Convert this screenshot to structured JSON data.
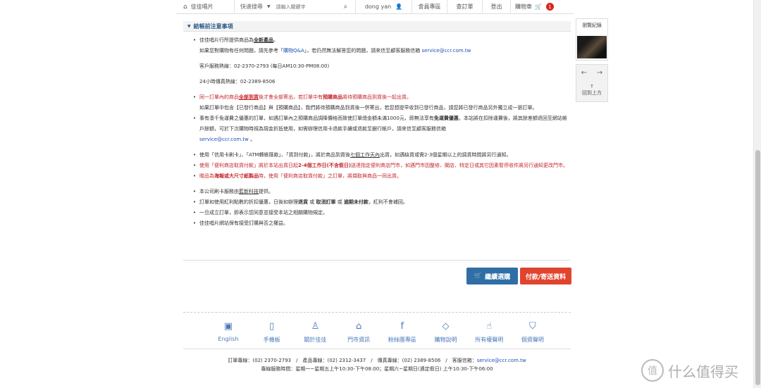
{
  "topbar": {
    "site_name": "佳佳唱片",
    "search_label": "快速搜尋",
    "search_placeholder": "請輸入關鍵字",
    "user": "dong yan",
    "member_zone": "會員專區",
    "check_order": "查訂單",
    "logout": "登出",
    "cart": "購物車",
    "cart_count": "1"
  },
  "sidebar": {
    "browse_history": "瀏覽紀錄",
    "back_to_top": "回到上方"
  },
  "notice": {
    "title": "結帳前注意事項",
    "l1": "佳佳唱片行所提供商品為",
    "l1_u": "全新產品",
    "l1_end": "。",
    "l2_pre": "如果您對購物有任何問題，請先參考「",
    "l2_link": "購物Q&A",
    "l2_mid": "」，若仍然無法解答您的問題，請來信至顧客服務信箱 ",
    "email": "service@ccr.com.tw",
    "l3": "客戶服務熱線：02-2370-2793 (每日AM10:30-PM08:00)",
    "l4": "24小時傳真熱線：02-2389-8506",
    "l5_pre": "同一訂單內的商品",
    "l5_u": "全部到貨",
    "l5_mid": "後才會全部寄出，若訂單中有",
    "l5_b": "預購商品",
    "l5_end": "將待預購商品到貨後一起出貨。",
    "l6": "如果訂單中包含【已發行商品】與【預購商品】，我們將待預購商品到貨後一併寄出，若您想提早收到已發行商品，請您將已發行商品另外獨立成一張訂單。",
    "l7_pre": "事有湊千免運費之優惠的訂單，如遇訂單內之預購商品調降價格而致使訂單總金額未滿1000元，即無法享有",
    "l7_b": "免運費優惠",
    "l7_end": "。本站將在扣除運費後，將其餘差額退回至網站帳戶餘額，可於下次購物時視為現金折抵使用，如需辦理信用卡退款手續或退款至銀行帳戶，請來信至顧客服務信箱",
    "l8": "使用「信用卡刷卡」、「ATM轉帳匯款」、「貨到付款」，將於商品到貨後",
    "l8_u": "七個工作天內",
    "l8_end": "出貨，如遇缺貨或需2-3個星期以上的調貨時間將另行通知。",
    "l9_pre": "使用「便利商店取貨付款」將於本站出貨日起",
    "l9_b": "2-4個工作日(不含假日)",
    "l9_end": "送達指定便利商店門市，如遇門市因整修、關店、特定日或其它因素暫停收件將另行通知更改門市。",
    "l10_pre": "贈品為",
    "l10_b": "海報或大尺寸紙製品",
    "l10_end": "時，使用「便利商店取貨付款」之訂單，將擷取與商品一同出貨。",
    "l11_pre": "本公司刷卡服務由",
    "l11_u": "藍新科技",
    "l11_end": "提供。",
    "l12_pre": "訂單如使用紅利點數的折扣優惠，日後如辦理",
    "l12_b1": "退貨",
    "l12_or": "或",
    "l12_b2": "取消訂單",
    "l12_or2": "或",
    "l12_b3": "逾期未付款",
    "l12_end": "，紅利不會補回。",
    "l13": "一旦成立訂單，即表示您同意並接受本站之相關購物規定。",
    "l14": "佳佳唱片網站保有接受訂購與否之權益。"
  },
  "buttons": {
    "continue": "繼續選購",
    "checkout": "付款/寄送資料"
  },
  "footer_nav": [
    {
      "label": "English"
    },
    {
      "label": "手機板"
    },
    {
      "label": "關於佳佳"
    },
    {
      "label": "門市資訊"
    },
    {
      "label": "粉絲團專區"
    },
    {
      "label": "購物說明"
    },
    {
      "label": "所有權聲明"
    },
    {
      "label": "個資聲明"
    }
  ],
  "contact": {
    "line1_pre": "訂單專線：(02) 2370-2793　/　產品專線：(02) 2312-3437　/　傳真專線：(02) 2389-8506　/　客服信箱：",
    "email": "service@ccr.com.tw",
    "line2": "專線服務時間：星期一~星期五上午10:30-下午08:00；星期六~星期日(遇定假日) 上午10:30-下午06:00"
  },
  "watermark": "什么值得买",
  "colors": {
    "accent_blue": "#2f6ea6",
    "accent_red": "#e0442f",
    "notice_red": "#c6262b",
    "link_blue": "#1d4fb8"
  }
}
